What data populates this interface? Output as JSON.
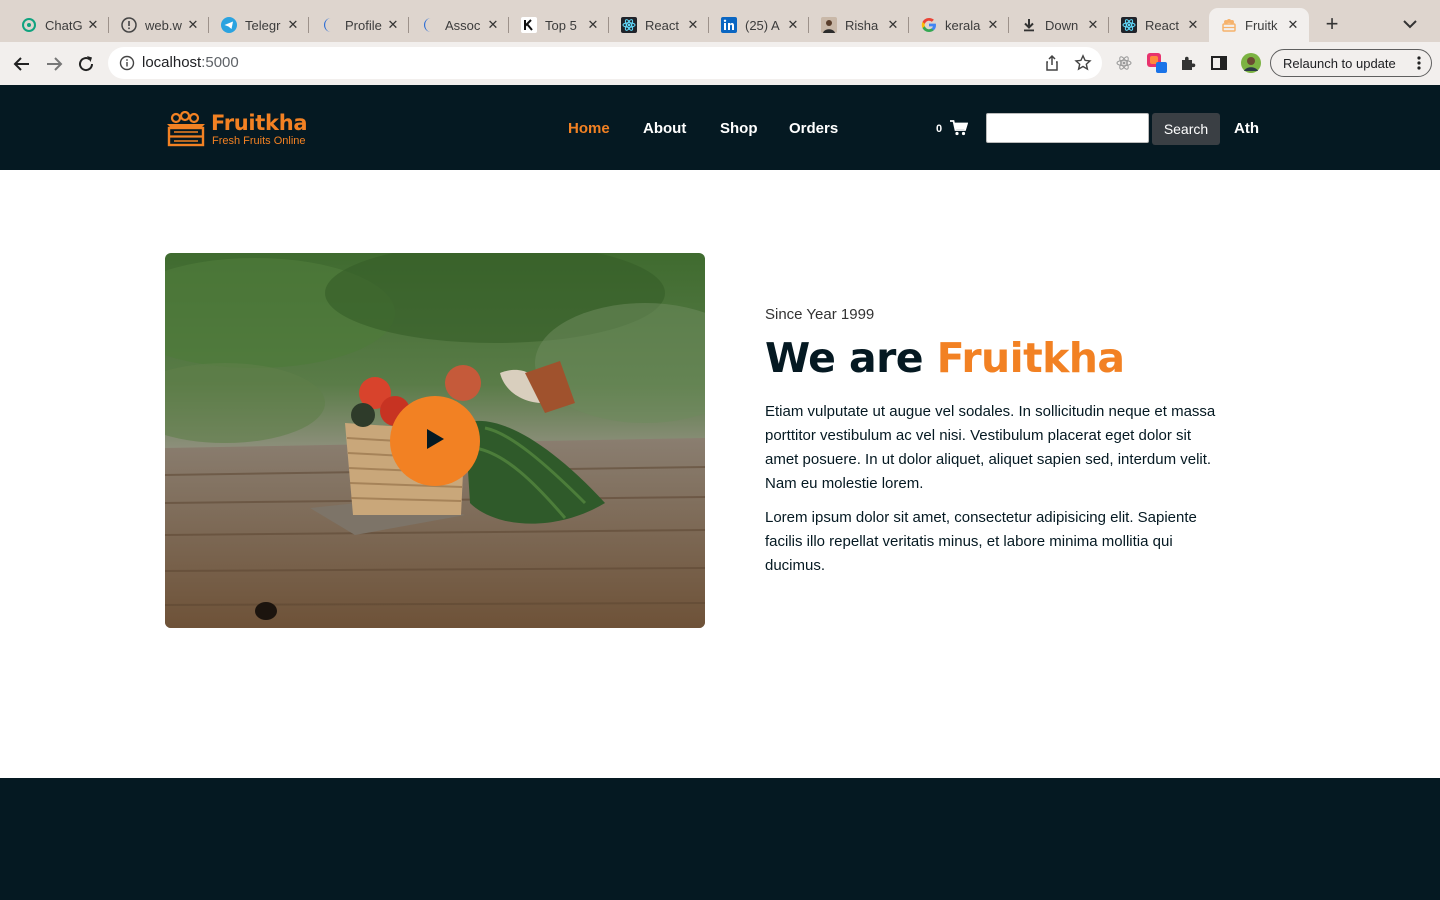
{
  "browser": {
    "tabs": [
      {
        "label": "ChatG",
        "icon": "chatgpt-icon"
      },
      {
        "label": "web.w",
        "icon": "warning-icon"
      },
      {
        "label": "Telegr",
        "icon": "telegram-icon"
      },
      {
        "label": "Profile",
        "icon": "crescent-icon"
      },
      {
        "label": "Assoc",
        "icon": "crescent-icon"
      },
      {
        "label": "Top 5",
        "icon": "k-logo-icon"
      },
      {
        "label": "React",
        "icon": "react-icon"
      },
      {
        "label": "(25) A",
        "icon": "linkedin-icon"
      },
      {
        "label": "Risha",
        "icon": "person-avatar-icon"
      },
      {
        "label": "kerala",
        "icon": "google-icon"
      },
      {
        "label": "Down",
        "icon": "download-icon"
      },
      {
        "label": "React",
        "icon": "react-icon"
      },
      {
        "label": "Fruitk",
        "icon": "fruit-basket-icon",
        "active": true
      }
    ],
    "url_host": "localhost",
    "url_port": ":5000",
    "relaunch_label": "Relaunch to update"
  },
  "header": {
    "logo_name": "Fruitkha",
    "logo_tagline": "Fresh Fruits Online",
    "nav": {
      "home": "Home",
      "about": "About",
      "shop": "Shop",
      "orders": "Orders"
    },
    "cart_count": "0",
    "search_value": "",
    "search_label": "Search",
    "user_name": "Ath"
  },
  "about": {
    "since": "Since Year 1999",
    "headline_prefix": "We are ",
    "headline_brand": "Fruitkha",
    "paragraph_1": "Etiam vulputate ut augue vel sodales. In sollicitudin neque et massa porttitor vestibulum ac vel nisi. Vestibulum placerat eget dolor sit amet posuere. In ut dolor aliquet, aliquet sapien sed, interdum velit. Nam eu molestie lorem.",
    "paragraph_2": "Lorem ipsum dolor sit amet, consectetur adipisicing elit. Sapiente facilis illo repellat veritatis minus, et labore minima mollitia qui ducimus."
  },
  "colors": {
    "brand_orange": "#f28123",
    "dark_navy": "#051922",
    "tab_strip": "#ded5ce",
    "toolbar": "#f2efed"
  }
}
